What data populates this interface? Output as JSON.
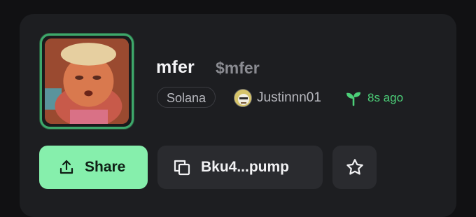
{
  "token": {
    "name": "mfer",
    "ticker": "$mfer",
    "chain": "Solana",
    "creator": "Justinnn01",
    "time_ago": "8s ago"
  },
  "actions": {
    "share_label": "Share",
    "address_label": "Bku4...pump"
  },
  "icons": {
    "share": "share-upload-icon",
    "copy": "copy-icon",
    "star": "star-icon",
    "sprout": "sprout-icon"
  },
  "colors": {
    "accent_green": "#86efac",
    "time_green": "#4ccf78",
    "avatar_border": "#3ea86b"
  }
}
